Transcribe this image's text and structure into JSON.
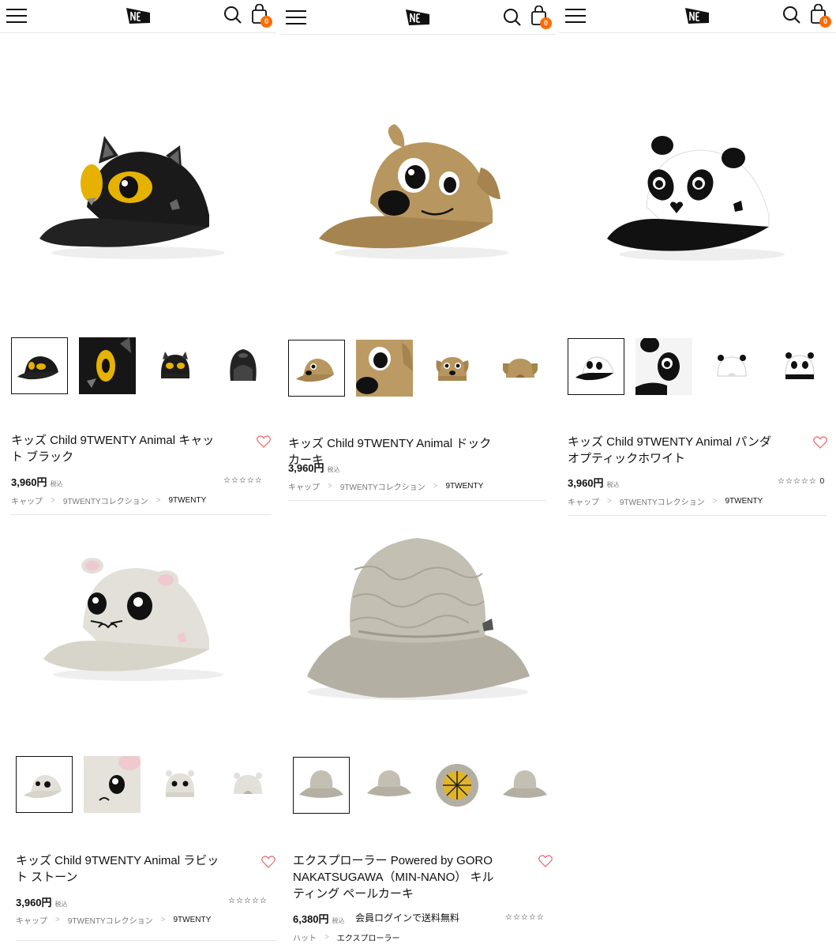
{
  "cart_count": "0",
  "colors": {
    "accent": "#ff6a00",
    "heart": "#f07070"
  },
  "products": [
    {
      "title": "キッズ Child 9TWENTY Animal キャット ブラック",
      "price": "3,960円",
      "tax": "税込",
      "stars": "☆☆☆☆☆",
      "breadcrumbs": [
        "キャップ",
        "9TWENTYコレクション",
        "9TWENTY"
      ]
    },
    {
      "title": "キッズ Child 9TWENTY Animal ドック カーキ",
      "price": "3,960円",
      "tax": "税込",
      "breadcrumbs": [
        "キャップ",
        "9TWENTYコレクション",
        "9TWENTY"
      ]
    },
    {
      "title": "キッズ Child 9TWENTY Animal パンダ オプティックホワイト",
      "price": "3,960円",
      "tax": "税込",
      "stars": "☆☆☆☆☆ 0",
      "breadcrumbs": [
        "キャップ",
        "9TWENTYコレクション",
        "9TWENTY"
      ]
    },
    {
      "title": "キッズ Child 9TWENTY Animal ラビット ストーン",
      "price": "3,960円",
      "tax": "税込",
      "stars": "☆☆☆☆☆",
      "breadcrumbs": [
        "キャップ",
        "9TWENTYコレクション",
        "9TWENTY"
      ]
    },
    {
      "title": "エクスプローラー Powered by GORO NAKATSUGAWA（MIN-NANO） キルティング ペールカーキ",
      "price": "6,380円",
      "tax": "税込",
      "promo": "会員ログインで送料無料",
      "stars": "☆☆☆☆☆",
      "breadcrumbs": [
        "ハット",
        "エクスプローラー"
      ]
    }
  ]
}
